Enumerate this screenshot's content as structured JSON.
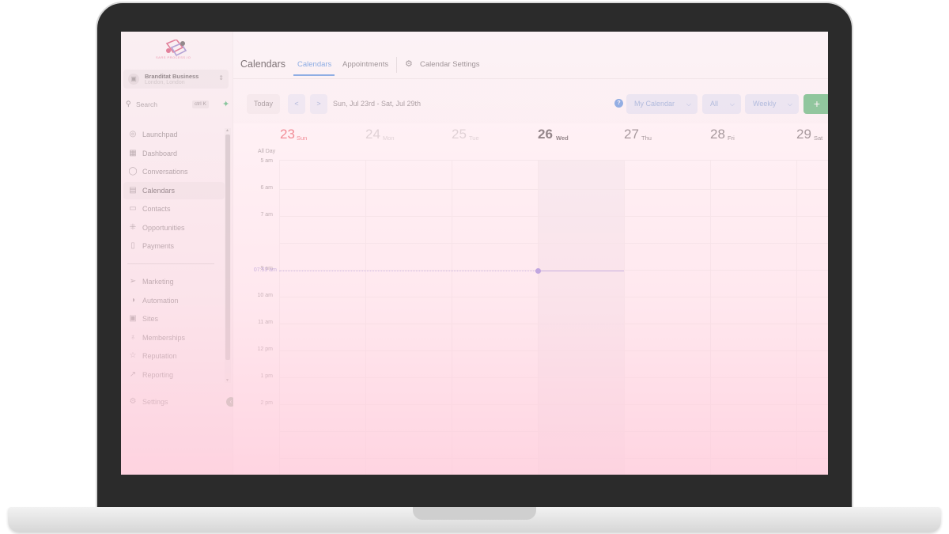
{
  "sidebar": {
    "logo_text": "SARS PROCESS.IO",
    "account": {
      "name": "Branditat Business",
      "location": "London, London"
    },
    "search": {
      "placeholder": "Search",
      "shortcut": "ctrl K"
    },
    "items": [
      {
        "label": "Launchpad",
        "icon": "rocket-icon"
      },
      {
        "label": "Dashboard",
        "icon": "dashboard-icon"
      },
      {
        "label": "Conversations",
        "icon": "chat-icon"
      },
      {
        "label": "Calendars",
        "icon": "calendar-icon",
        "active": true
      },
      {
        "label": "Contacts",
        "icon": "contacts-icon"
      },
      {
        "label": "Opportunities",
        "icon": "opportunities-icon"
      },
      {
        "label": "Payments",
        "icon": "payments-icon"
      },
      {
        "label": "Marketing",
        "icon": "send-icon"
      },
      {
        "label": "Automation",
        "icon": "automation-icon"
      },
      {
        "label": "Sites",
        "icon": "sites-icon"
      },
      {
        "label": "Memberships",
        "icon": "award-icon"
      },
      {
        "label": "Reputation",
        "icon": "star-icon"
      },
      {
        "label": "Reporting",
        "icon": "trend-icon"
      }
    ],
    "settings_label": "Settings"
  },
  "header": {
    "title": "Calendars",
    "tabs": [
      {
        "label": "Calendars",
        "active": true
      },
      {
        "label": "Appointments"
      },
      {
        "label": "Calendar Settings"
      }
    ]
  },
  "toolbar": {
    "today_label": "Today",
    "prev_label": "<",
    "next_label": ">",
    "date_range": "Sun, Jul 23rd - Sat, Jul 29th",
    "help_label": "?",
    "calendar_select": "My Calendar",
    "filter_select": "All",
    "view_select": "Weekly",
    "add_label": "+"
  },
  "calendar": {
    "days": [
      {
        "num": "23",
        "name": "Sun"
      },
      {
        "num": "24",
        "name": "Mon"
      },
      {
        "num": "25",
        "name": "Tue"
      },
      {
        "num": "26",
        "name": "Wed"
      },
      {
        "num": "27",
        "name": "Thu"
      },
      {
        "num": "28",
        "name": "Fri"
      },
      {
        "num": "29",
        "name": "Sat"
      }
    ],
    "all_day_label": "All Day",
    "times": [
      "5 am",
      "6 am",
      "7 am",
      "9 am",
      "10 am",
      "11 am",
      "12 pm",
      "1 pm",
      "2 pm"
    ],
    "now_label": "07:53 am"
  },
  "colors": {
    "accent": "#4a8ee0",
    "today_sun": "#e8505b",
    "add_button": "#47b66b",
    "now_indicator": "#7b6fdd",
    "overlay_pink": "#ffd5e1"
  }
}
